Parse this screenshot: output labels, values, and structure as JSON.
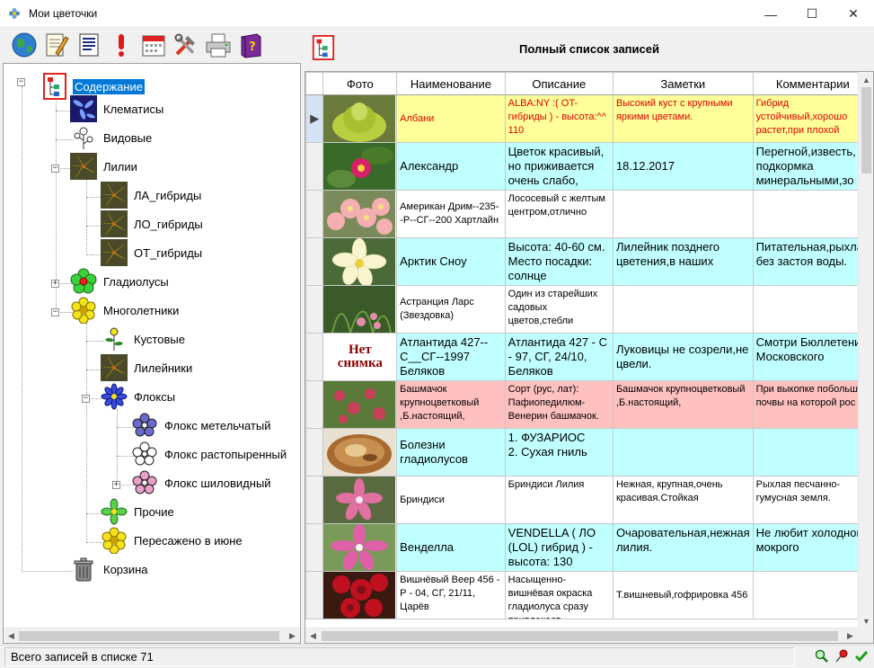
{
  "window": {
    "title": "Мои цветочки",
    "minimize": "—",
    "maximize": "☐",
    "close": "✕"
  },
  "toolbar": {
    "buttons": [
      "globe-icon",
      "notepad-edit-icon",
      "document-list-icon",
      "exclamation-icon",
      "calendar-icon",
      "tools-icon",
      "printer-icon",
      "help-book-icon"
    ]
  },
  "tree": {
    "nodes": [
      {
        "label": "Содержание",
        "selected": true
      },
      {
        "label": "Клематисы"
      },
      {
        "label": "Видовые"
      },
      {
        "label": "Лилии"
      },
      {
        "label": "ЛА_гибриды"
      },
      {
        "label": "ЛО_гибриды"
      },
      {
        "label": "ОТ_гибриды"
      },
      {
        "label": "Гладиолусы"
      },
      {
        "label": "Многолетники"
      },
      {
        "label": "Кустовые"
      },
      {
        "label": "Лилейники"
      },
      {
        "label": "Флоксы"
      },
      {
        "label": "Флокс  метельчатый"
      },
      {
        "label": "Флокс растопыренный"
      },
      {
        "label": "Флокс шиловидный"
      },
      {
        "label": "Прочие"
      },
      {
        "label": "Пересажено в июне"
      },
      {
        "label": "Корзина"
      }
    ]
  },
  "grid": {
    "title": "Полный список записей",
    "columns": [
      "Фото",
      "Наименование",
      "Описание",
      "Заметки",
      "Комментарии"
    ],
    "no_photo_line1": "Нет",
    "no_photo_line2": "снимка",
    "rows": [
      {
        "name": "Албани",
        "desc": "ALBA:NY :( OT-гибриды ) - высота:^^ 110",
        "notes": "Высокий куст с крупными яркими цветами.",
        "comments": "Гибрид устойчивый,хорошо растет,при плохой",
        "color": "yellow"
      },
      {
        "name": "Александр",
        "desc": "Цветок красивый, но приживается очень слабо,",
        "notes": "18.12.2017",
        "comments": "Перегной,известь, подкормка минеральными,зо",
        "color": "cyan"
      },
      {
        "name": "Американ Дрим--235--Р--СГ--200 Хартлайн",
        "desc": "Лососевый с желтым центром,отлично",
        "notes": "",
        "comments": "",
        "color": "white"
      },
      {
        "name": "Арктик Сноу",
        "desc": "Высота: 40-60 см. Место посадки: солнце",
        "notes": "Лилейник позднего цветения,в наших",
        "comments": "Питательная,рыхлая без застоя воды.",
        "color": "cyan"
      },
      {
        "name": "Астранция  Ларс (Звездовка)",
        "desc": "Один из старейших садовых цветов,стебли",
        "notes": "",
        "comments": "",
        "color": "white"
      },
      {
        "name": "Атлантида 427--С__СГ--1997 Беляков",
        "desc": "Атлантида 427 - С - 97, СГ, 24/10, Беляков",
        "notes": "Луковицы не созрели,не цвели.",
        "comments": "Смотри Бюллетени Московского",
        "color": "cyan"
      },
      {
        "name": "Башмачок крупноцветковый ,Б.настоящий,",
        "desc": "Сорт (рус, лат): Пафиопедилюм-Венерин башмачок.",
        "notes": "Башмачок крупноцветковый ,Б.настоящий,",
        "comments": "При выкопке побольше почвы на которой рос",
        "color": "pink"
      },
      {
        "name": "Болезни гладиолусов",
        "desc": "1. ФУЗАРИОС\n  2.  Сухая гниль",
        "notes": "",
        "comments": "",
        "color": "cyan"
      },
      {
        "name": "Бриндиси",
        "desc": "Бриндиси Лилия",
        "notes": "Нежная, крупная,очень красивая.Стойкая",
        "comments": "Рыхлая песчанно-гумусная земля.",
        "color": "white"
      },
      {
        "name": "Венделла",
        "desc": "VENDELLA ( ЛО (LOL) гибрид ) - высота: 130",
        "notes": "Очаровательная,нежная лилия.",
        "comments": "Не любит холодного мокрого",
        "color": "cyan"
      },
      {
        "name": "Вишнёвый Веер 456 - Р - 04, СГ, 21/11, Царёв",
        "desc": "Насыщенно-вишнёвая окраска гладиолуса сразу привлекает",
        "notes": "Т.вишневый,гофрировка 456",
        "comments": "",
        "color": "white"
      }
    ]
  },
  "status": {
    "text": "Всего записей в списке 71"
  }
}
